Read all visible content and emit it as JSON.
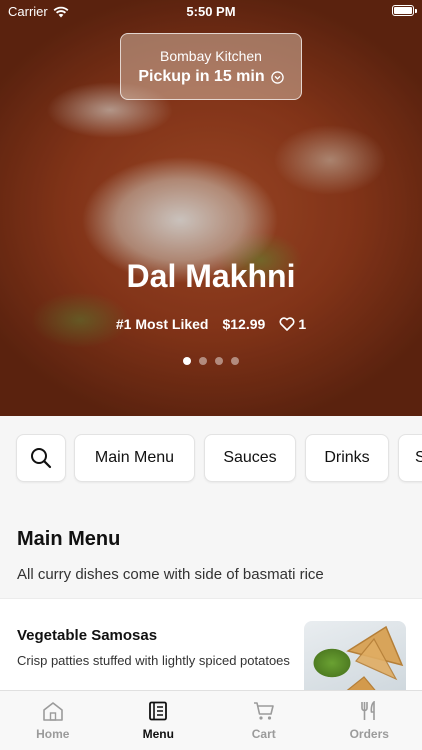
{
  "status_bar": {
    "carrier": "Carrier",
    "time": "5:50 PM"
  },
  "store": {
    "name": "Bombay Kitchen",
    "pickup": "Pickup in 15 min"
  },
  "hero": {
    "dish": "Dal Makhni",
    "badge": "#1 Most Liked",
    "price": "$12.99",
    "likes": "1",
    "slide_count": 4,
    "active_slide": 1
  },
  "categories": [
    {
      "label": "Main Menu"
    },
    {
      "label": "Sauces"
    },
    {
      "label": "Drinks"
    },
    {
      "label": "S"
    }
  ],
  "section": {
    "title": "Main Menu",
    "subtitle": "All curry dishes come with side of basmati rice"
  },
  "items": [
    {
      "name": "Vegetable Samosas",
      "description": "Crisp patties stuffed with lightly spiced potatoes"
    }
  ],
  "tabs": [
    {
      "label": "Home",
      "icon": "home-icon",
      "active": false
    },
    {
      "label": "Menu",
      "icon": "menu-icon",
      "active": true
    },
    {
      "label": "Cart",
      "icon": "cart-icon",
      "active": false
    },
    {
      "label": "Orders",
      "icon": "utensils-icon",
      "active": false
    }
  ],
  "colors": {
    "tab_active": "#111111",
    "tab_inactive": "#9b9b9b"
  }
}
